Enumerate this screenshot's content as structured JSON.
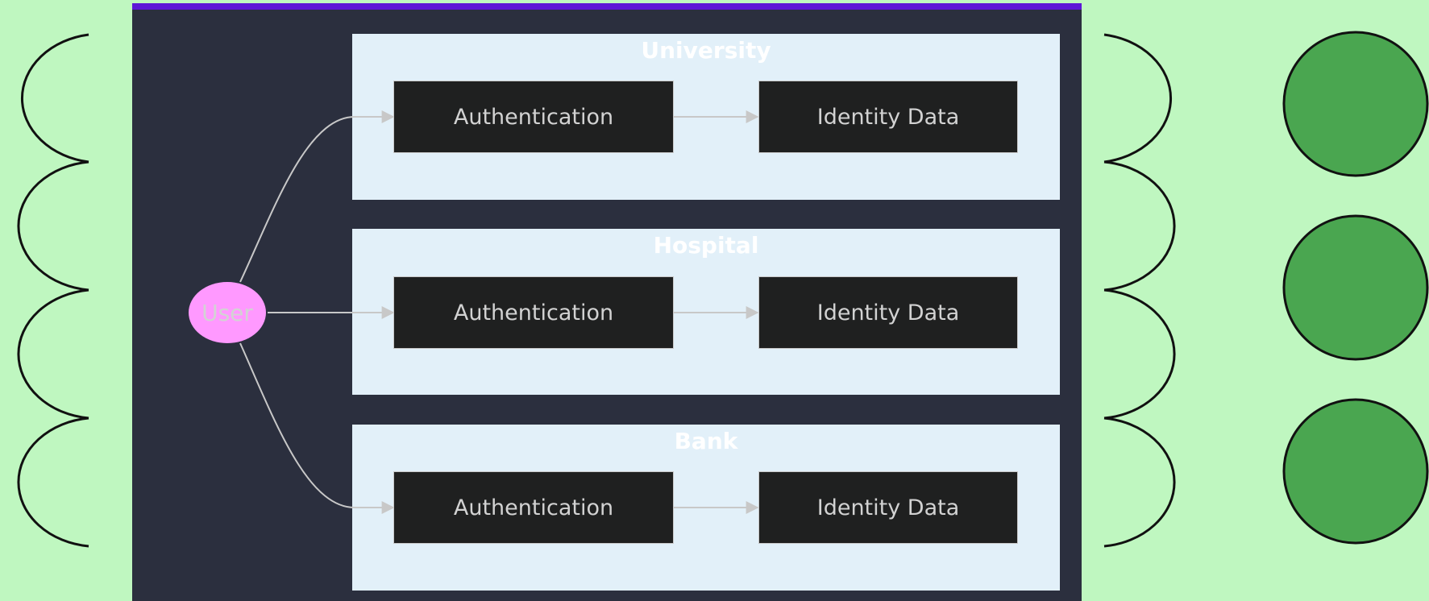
{
  "user": {
    "label": "User"
  },
  "clusters": [
    {
      "title": "University",
      "auth_label": "Authentication",
      "data_label": "Identity Data"
    },
    {
      "title": "Hospital",
      "auth_label": "Authentication",
      "data_label": "Identity Data"
    },
    {
      "title": "Bank",
      "auth_label": "Authentication",
      "data_label": "Identity Data"
    }
  ],
  "colors": {
    "background": "#bff7c0",
    "panel": "#2b2f3e",
    "panel_top_bar": "#5d17d6",
    "cluster_fill": "#e2f0f9",
    "node_fill": "#1f2020",
    "user_fill": "#ff99ff",
    "circle_fill": "#4aa650",
    "edge": "#c8c8c8"
  }
}
